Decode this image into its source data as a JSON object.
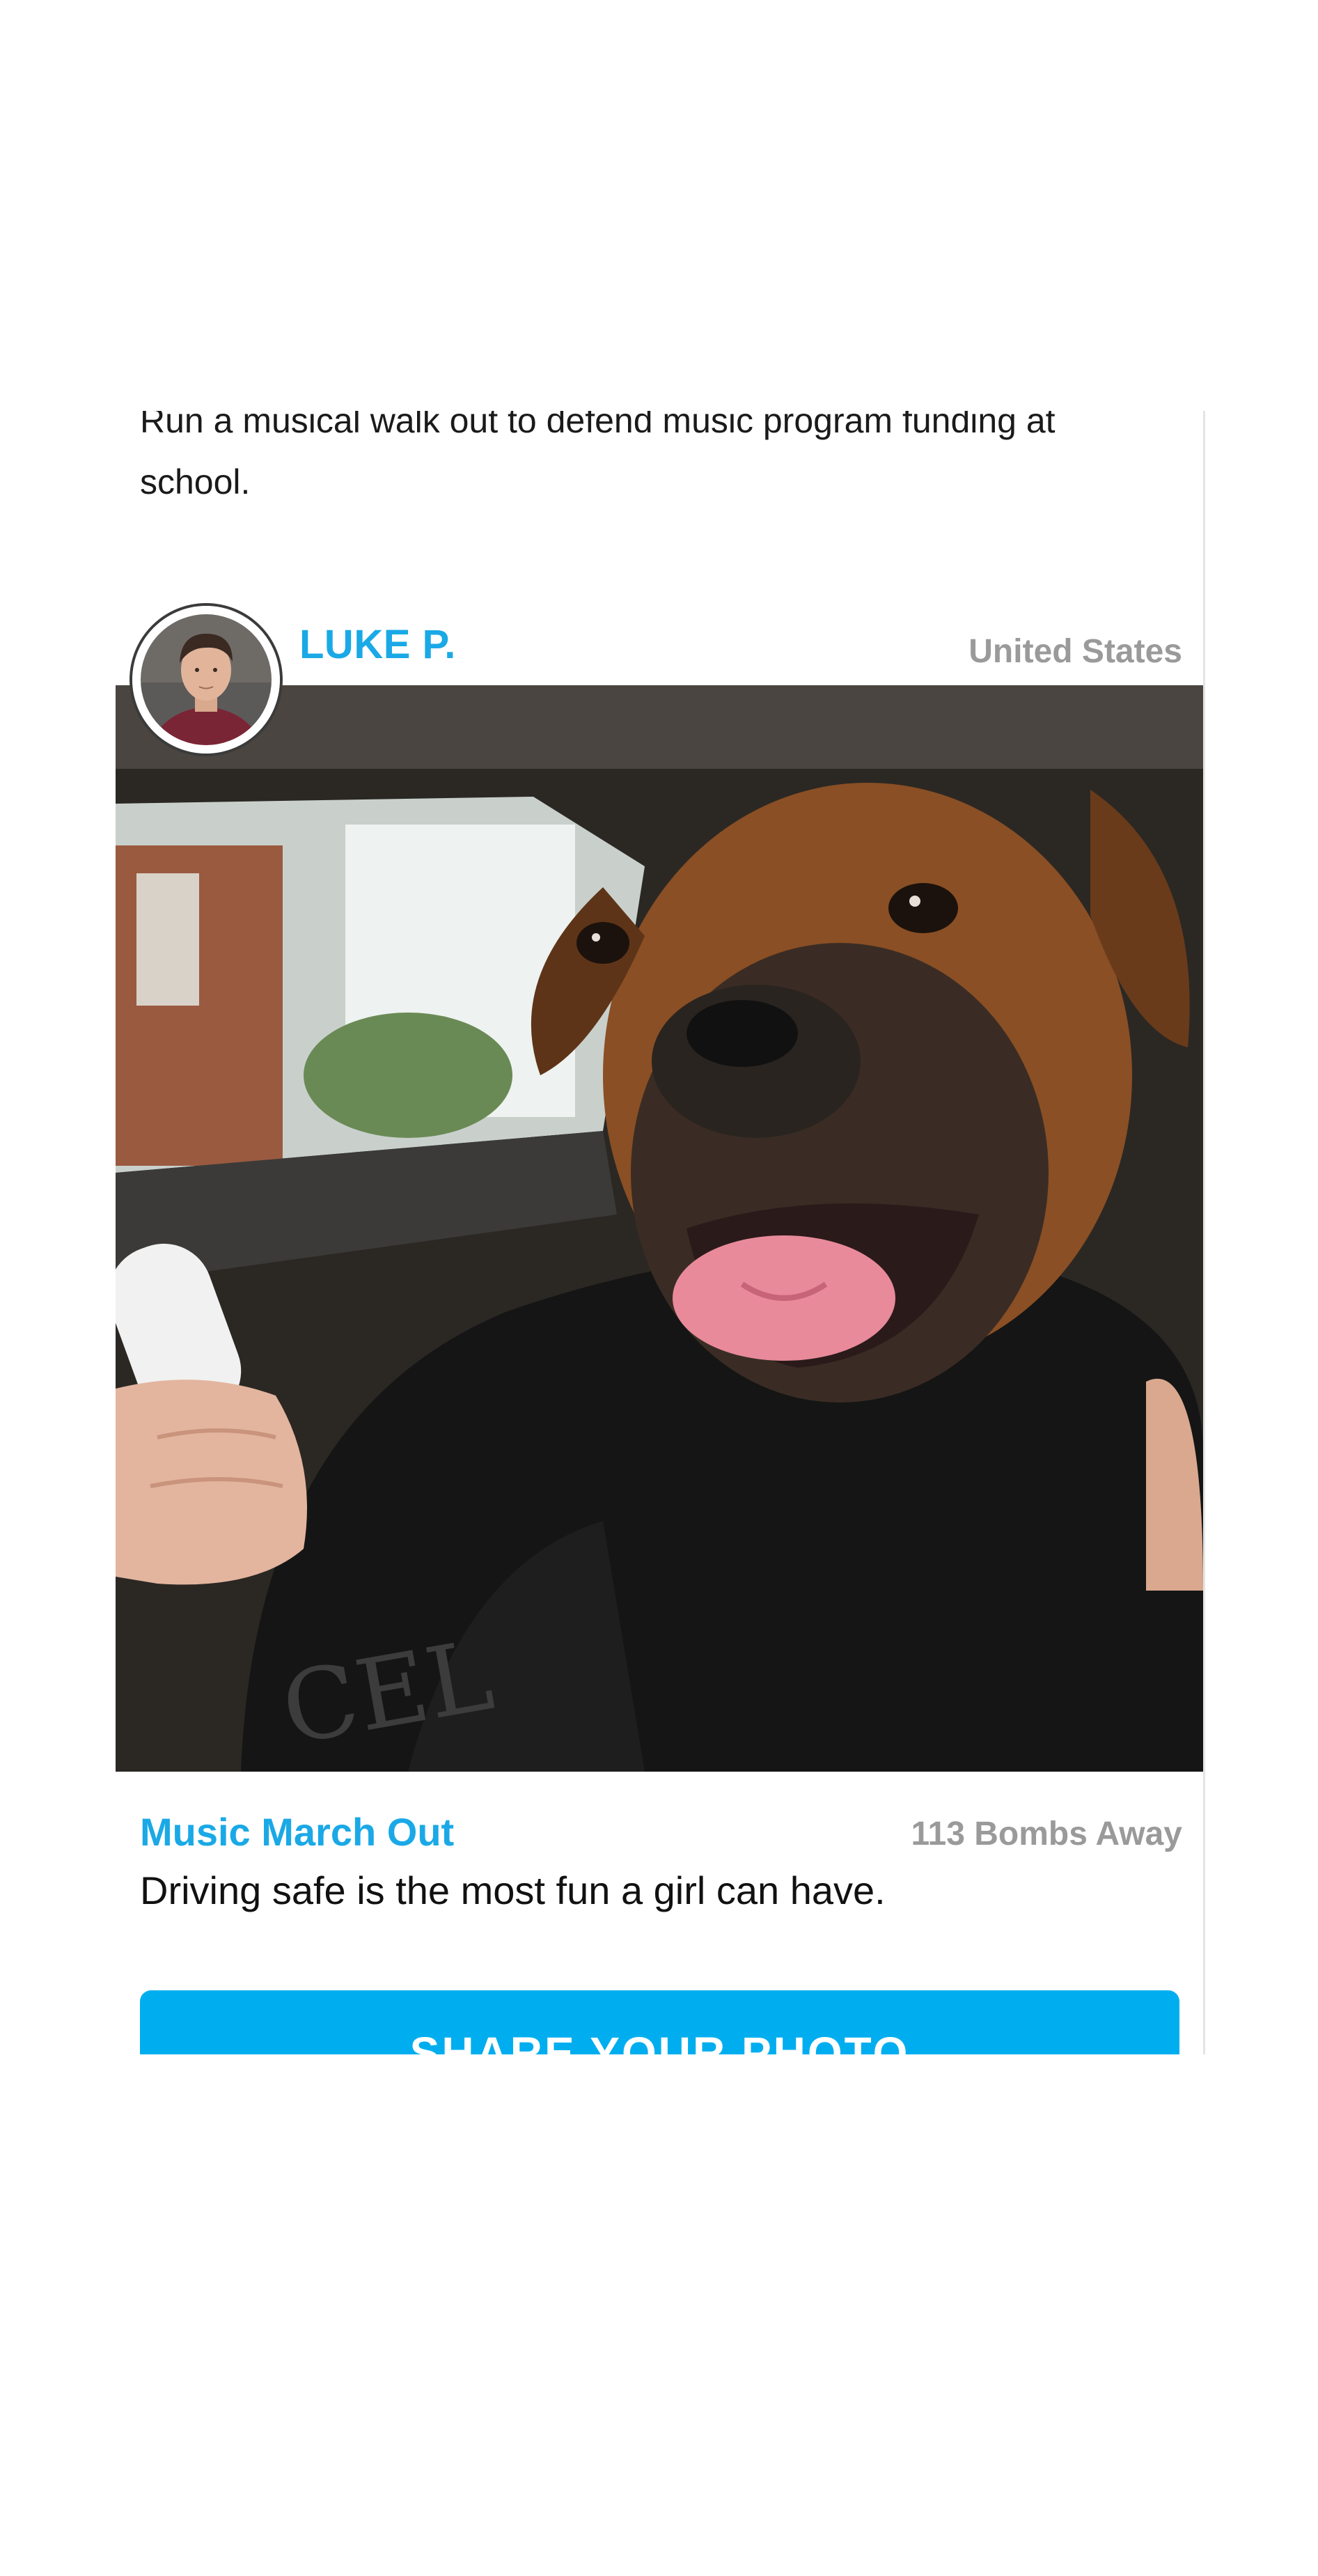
{
  "intro": {
    "text": "Run a musical walk out to defend music program funding at school."
  },
  "post": {
    "author_name": "LUKE P.",
    "location": "United States",
    "challenge_title": "Music March Out",
    "bombs_label": "113 Bombs Away",
    "caption": "Driving safe is the most fun a girl can have."
  },
  "actions": {
    "share_label": "SHARE YOUR PHOTO"
  },
  "colors": {
    "accent": "#1aa9e6",
    "button": "#00aeef",
    "muted_text": "#9a9a9a"
  }
}
